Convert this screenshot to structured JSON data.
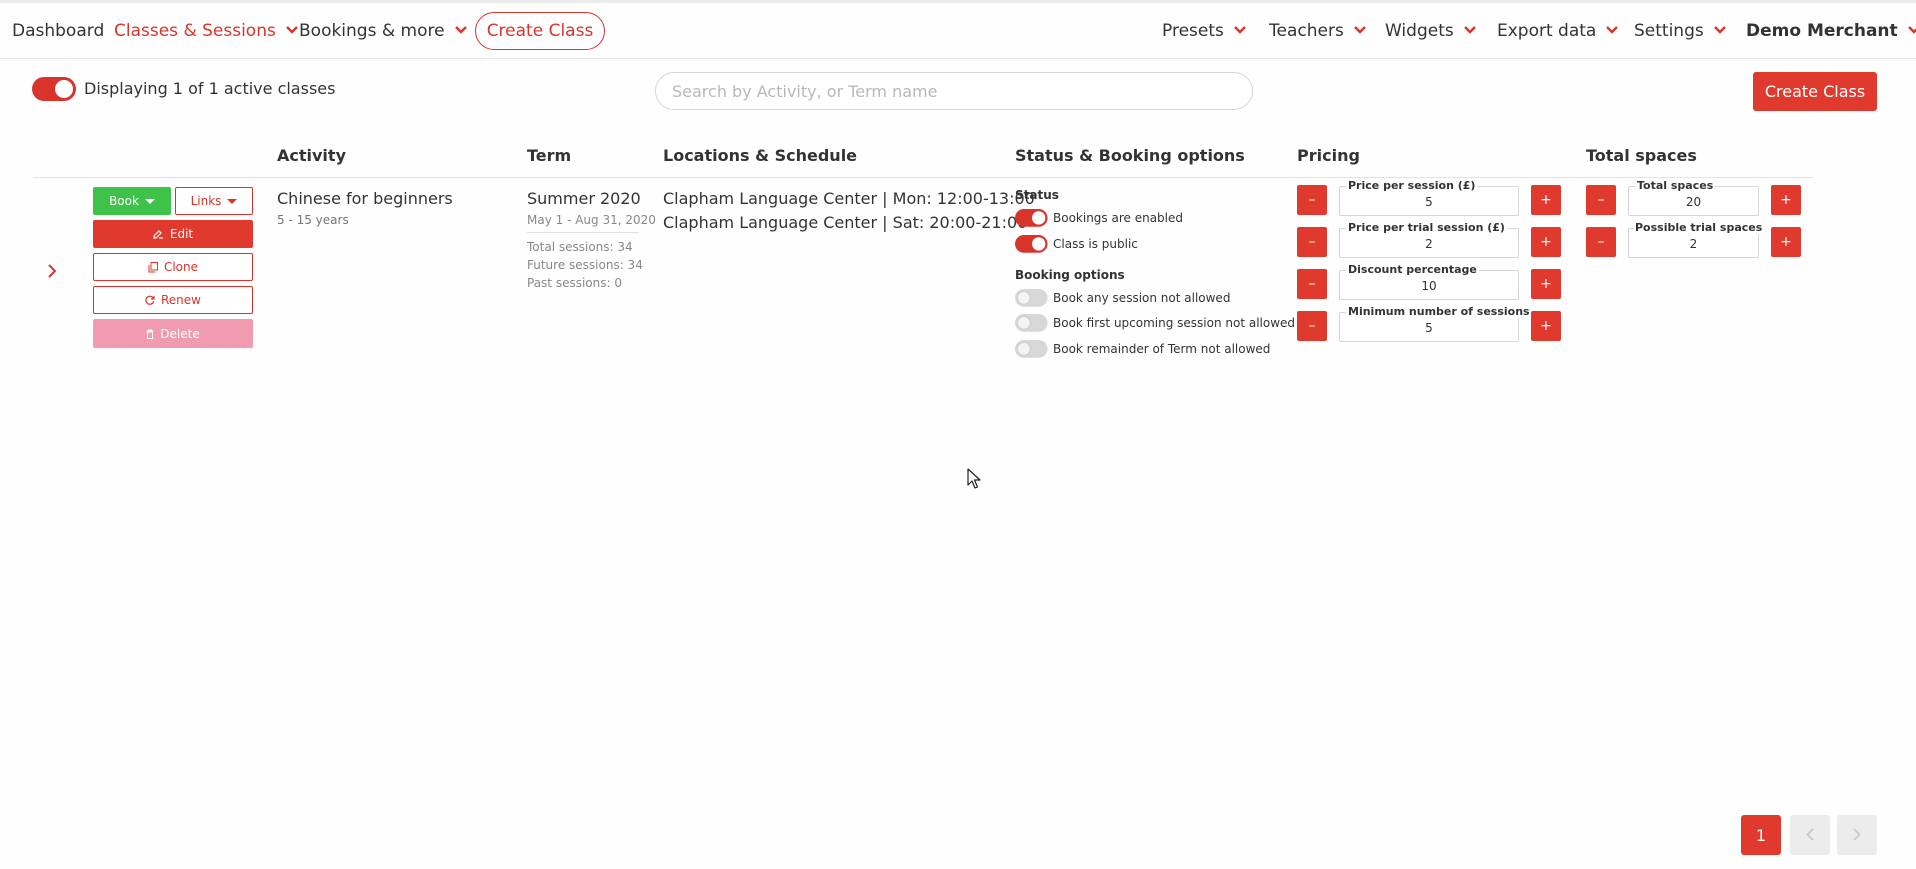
{
  "nav": {
    "left": [
      {
        "label": "Dashboard",
        "dropdown": false,
        "active": false
      },
      {
        "label": "Classes & Sessions",
        "dropdown": true,
        "active": true
      },
      {
        "label": "Bookings & more",
        "dropdown": true,
        "active": false
      }
    ],
    "create_class_label": "Create Class",
    "right": [
      {
        "label": "Presets"
      },
      {
        "label": "Teachers"
      },
      {
        "label": "Widgets"
      },
      {
        "label": "Export data"
      },
      {
        "label": "Settings"
      },
      {
        "label": "Demo Merchant"
      }
    ]
  },
  "subheader": {
    "active_toggle_on": true,
    "display_text": "Displaying 1 of 1 active classes",
    "search_placeholder": "Search by Activity, or Term name",
    "search_value": "",
    "create_class_label": "Create Class"
  },
  "table": {
    "headers": [
      "Activity",
      "Term",
      "Locations & Schedule",
      "Status & Booking options",
      "Pricing",
      "Total spaces"
    ],
    "rows": [
      {
        "actions": {
          "book": "Book",
          "links": "Links",
          "edit": "Edit",
          "clone": "Clone",
          "renew": "Renew",
          "delete": "Delete"
        },
        "activity": {
          "name": "Chinese for beginners",
          "age": "5 - 15 years"
        },
        "term": {
          "name": "Summer 2020",
          "dates": "May 1 - Aug 31, 2020",
          "stats": [
            "Total sessions: 34",
            "Future sessions: 34",
            "Past sessions: 0"
          ]
        },
        "locations": [
          "Clapham Language Center | Mon: 12:00-13:00",
          "Clapham Language Center | Sat: 20:00-21:00"
        ],
        "status": {
          "label": "Status",
          "items": [
            {
              "label": "Bookings are enabled",
              "on": true
            },
            {
              "label": "Class is public",
              "on": true
            }
          ]
        },
        "booking_options": {
          "label": "Booking options",
          "items": [
            {
              "label": "Book any session not allowed",
              "on": false
            },
            {
              "label": "Book first upcoming session not allowed",
              "on": false
            },
            {
              "label": "Book remainder of Term not allowed",
              "on": false
            }
          ]
        },
        "pricing": [
          {
            "label": "Price per session (£)",
            "value": "5"
          },
          {
            "label": "Price per trial session (£)",
            "value": "2"
          },
          {
            "label": "Discount percentage",
            "value": "10"
          },
          {
            "label": "Minimum number of sessions",
            "value": "5"
          }
        ],
        "spaces": [
          {
            "label": "Total spaces",
            "value": "20"
          },
          {
            "label": "Possible trial spaces",
            "value": "2"
          }
        ]
      }
    ]
  },
  "pagination": {
    "current": "1"
  },
  "colors": {
    "accent": "#e03a2e",
    "book_green": "#3fc24a",
    "delete_pink": "#f09bb0"
  }
}
